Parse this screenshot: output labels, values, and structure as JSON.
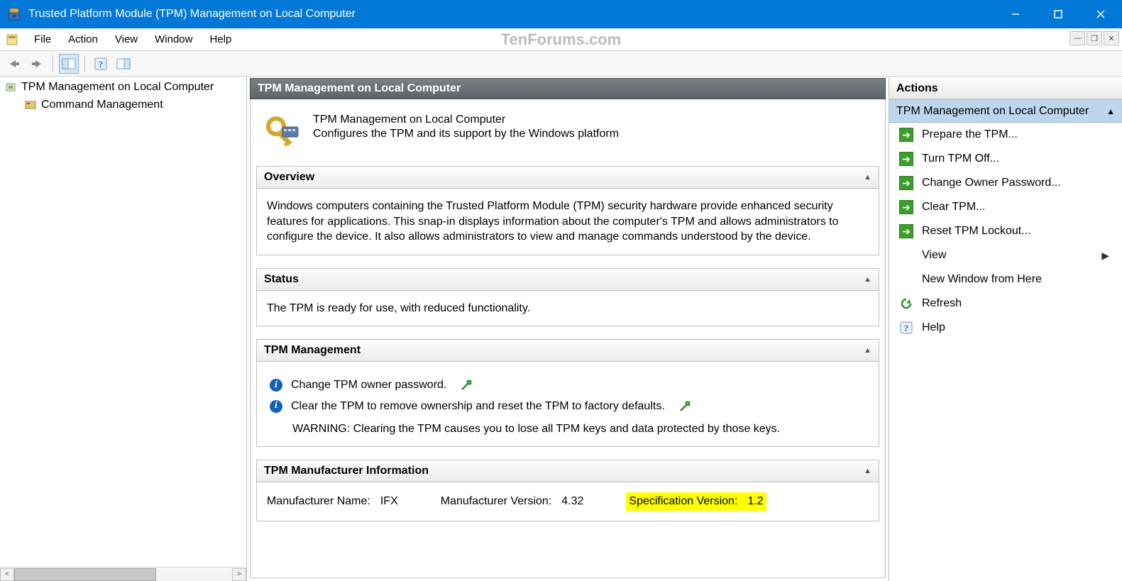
{
  "window": {
    "title": "Trusted Platform Module (TPM) Management on Local Computer"
  },
  "menubar": {
    "items": [
      "File",
      "Action",
      "View",
      "Window",
      "Help"
    ],
    "watermark": "TenForums.com"
  },
  "tree": {
    "root": "TPM Management on Local Computer",
    "child": "Command Management"
  },
  "center": {
    "header": "TPM Management on Local Computer",
    "intro_title": "TPM Management on Local Computer",
    "intro_sub": "Configures the TPM and its support by the Windows platform",
    "overview": {
      "title": "Overview",
      "body": "Windows computers containing the Trusted Platform Module (TPM) security hardware provide enhanced security features for applications. This snap-in displays information about the computer's TPM and allows administrators to configure the device. It also allows administrators to view and manage commands understood by the device."
    },
    "status": {
      "title": "Status",
      "body": "The TPM is ready for use, with reduced functionality."
    },
    "mgmt": {
      "title": "TPM Management",
      "item1": "Change TPM owner password.",
      "item2": "Clear the TPM to remove ownership and reset the TPM to factory defaults.",
      "warn": "WARNING: Clearing the TPM causes you to lose all TPM keys and data protected by those keys."
    },
    "mfr": {
      "title": "TPM Manufacturer Information",
      "name_label": "Manufacturer Name:",
      "name_value": "IFX",
      "ver_label": "Manufacturer Version:",
      "ver_value": "4.32",
      "spec_label": "Specification Version:",
      "spec_value": "1.2"
    }
  },
  "actions": {
    "header": "Actions",
    "group": "TPM Management on Local Computer",
    "items": [
      {
        "label": "Prepare the TPM...",
        "icon": "go"
      },
      {
        "label": "Turn TPM Off...",
        "icon": "go"
      },
      {
        "label": "Change Owner Password...",
        "icon": "go"
      },
      {
        "label": "Clear TPM...",
        "icon": "go"
      },
      {
        "label": "Reset TPM Lockout...",
        "icon": "go"
      },
      {
        "label": "View",
        "icon": "none",
        "submenu": true
      },
      {
        "label": "New Window from Here",
        "icon": "none"
      },
      {
        "label": "Refresh",
        "icon": "refresh"
      },
      {
        "label": "Help",
        "icon": "help"
      }
    ]
  }
}
